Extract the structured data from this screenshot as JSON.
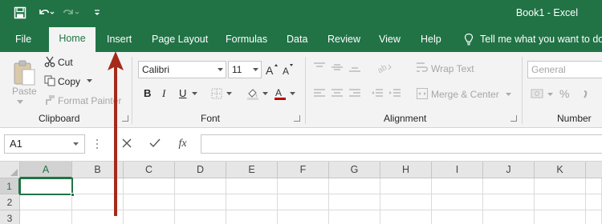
{
  "window": {
    "title": "Book1  -  Excel"
  },
  "colors": {
    "excel_green": "#217346",
    "arrow": "#a52a1a"
  },
  "quick_access": [
    "save-icon",
    "undo-icon",
    "redo-icon",
    "customize-icon"
  ],
  "tabs": [
    {
      "label": "File",
      "active": false
    },
    {
      "label": "Home",
      "active": true
    },
    {
      "label": "Insert",
      "active": false
    },
    {
      "label": "Page Layout",
      "active": false
    },
    {
      "label": "Formulas",
      "active": false
    },
    {
      "label": "Data",
      "active": false
    },
    {
      "label": "Review",
      "active": false
    },
    {
      "label": "View",
      "active": false
    },
    {
      "label": "Help",
      "active": false
    }
  ],
  "tell_me": "Tell me what you want to do",
  "ribbon": {
    "clipboard": {
      "label": "Clipboard",
      "paste": "Paste",
      "cut": "Cut",
      "copy": "Copy",
      "format_painter": "Format Painter"
    },
    "font": {
      "label": "Font",
      "font_name": "Calibri",
      "font_size": "11",
      "bold": "B",
      "italic": "I",
      "underline": "U"
    },
    "alignment": {
      "label": "Alignment",
      "wrap_text": "Wrap Text",
      "merge_center": "Merge & Center"
    },
    "number": {
      "label": "Number",
      "format": "General",
      "percent": "%"
    }
  },
  "formula_bar": {
    "name_box": "A1",
    "fx": "fx",
    "formula": ""
  },
  "grid": {
    "columns": [
      "A",
      "B",
      "C",
      "D",
      "E",
      "F",
      "G",
      "H",
      "I",
      "J",
      "K"
    ],
    "rows": [
      "1",
      "2",
      "3"
    ],
    "selected_cell": "A1"
  }
}
